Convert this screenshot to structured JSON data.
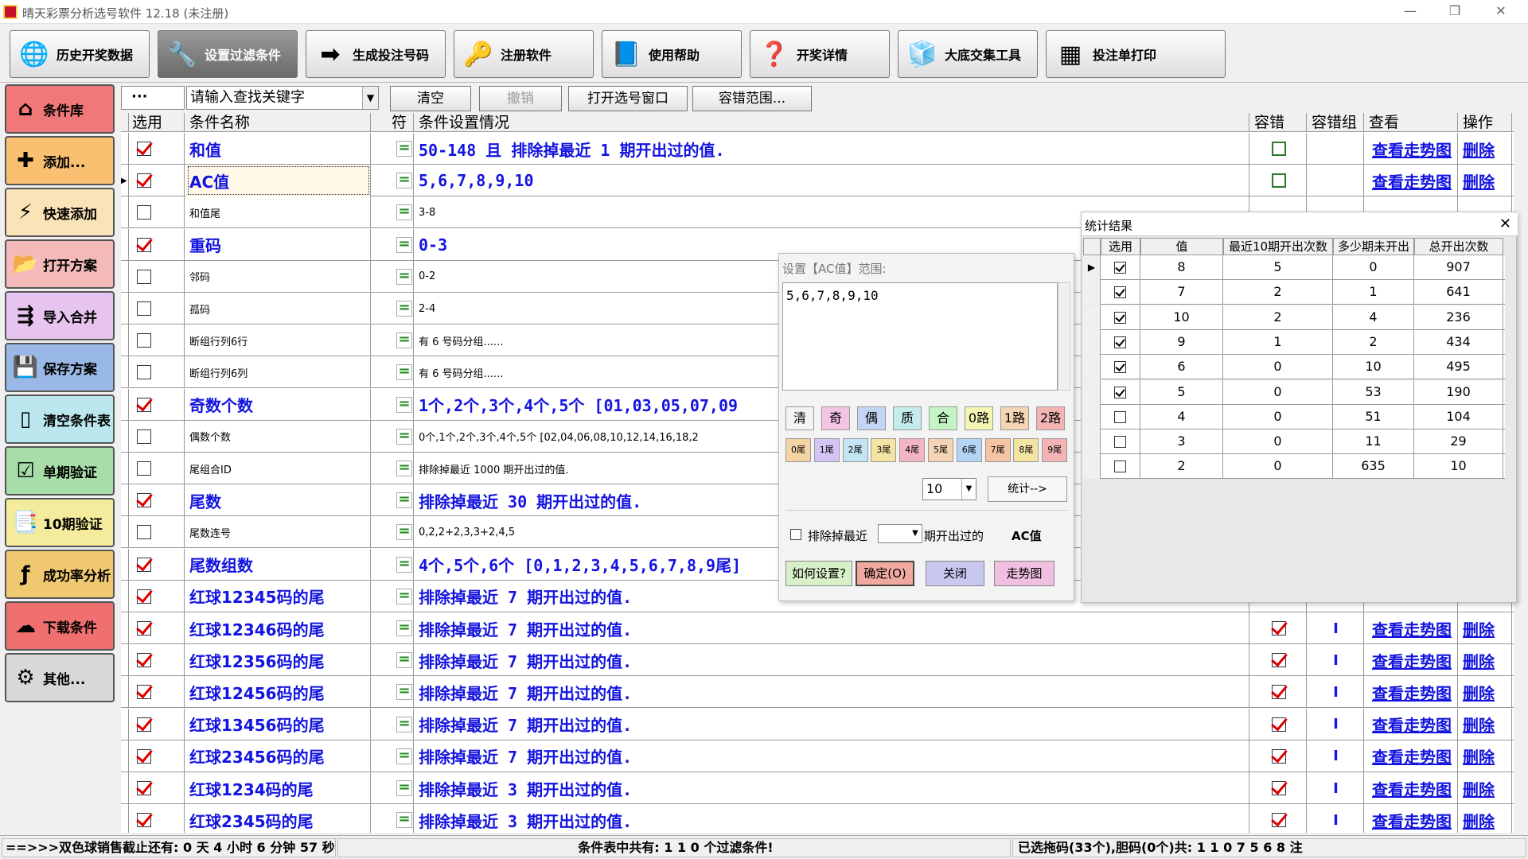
{
  "window": {
    "title": "晴天彩票分析选号软件 12.18 (未注册)",
    "min": "—",
    "max": "❐",
    "close": "✕"
  },
  "toolbar": [
    {
      "label": "历史开奖数据",
      "icon": "globe-icon",
      "glyph": "🌐"
    },
    {
      "label": "设置过滤条件",
      "icon": "tools-icon",
      "glyph": "🔧"
    },
    {
      "label": "生成投注号码",
      "icon": "arrow-right-icon",
      "glyph": "➡"
    },
    {
      "label": "注册软件",
      "icon": "key-icon",
      "glyph": "🔑"
    },
    {
      "label": "使用帮助",
      "icon": "help-book-icon",
      "glyph": "📘"
    },
    {
      "label": "开奖详情",
      "icon": "question-icon",
      "glyph": "❓"
    },
    {
      "label": "大底交集工具",
      "icon": "cubes-icon",
      "glyph": "🧊"
    },
    {
      "label": "投注单打印",
      "icon": "print-icon",
      "glyph": "▦"
    }
  ],
  "sidebar": [
    {
      "label": "条件库",
      "icon": "house-icon",
      "glyph": "⌂",
      "bg": "#f07878"
    },
    {
      "label": "添加...",
      "icon": "plus-icon",
      "glyph": "✚",
      "bg": "#f8c070"
    },
    {
      "label": "快速添加",
      "icon": "lightning-icon",
      "glyph": "⚡",
      "bg": "#fbe3b8"
    },
    {
      "label": "打开方案",
      "icon": "folder-icon",
      "glyph": "📂",
      "bg": "#f4b9b9"
    },
    {
      "label": "导入合并",
      "icon": "merge-icon",
      "glyph": "⇶",
      "bg": "#e6c4ef"
    },
    {
      "label": "保存方案",
      "icon": "disk-icon",
      "glyph": "💾",
      "bg": "#9ab8e6"
    },
    {
      "label": "清空条件表",
      "icon": "document-icon",
      "glyph": "▯",
      "bg": "#bce6ee"
    },
    {
      "label": "单期验证",
      "icon": "checklist-icon",
      "glyph": "☑",
      "bg": "#a8dca8"
    },
    {
      "label": "10期验证",
      "icon": "checklist10-icon",
      "glyph": "📑",
      "bg": "#f4ec9c"
    },
    {
      "label": "成功率分析",
      "icon": "fx-icon",
      "glyph": "ƒ",
      "bg": "#f0c870"
    },
    {
      "label": "下载条件",
      "icon": "cloud-download-icon",
      "glyph": "☁",
      "bg": "#f07070"
    },
    {
      "label": "其他...",
      "icon": "gear-icon",
      "glyph": "⚙",
      "bg": "#d8d8d8"
    }
  ],
  "filterbar": {
    "dots": "···",
    "search_placeholder": "请输入查找关键字",
    "dd": "▼",
    "clear": "清空",
    "undo": "撤销",
    "open_window": "打开选号窗口",
    "tolerance": "容错范围..."
  },
  "grid": {
    "headers": [
      "选用",
      "条件名称",
      "符",
      "条件设置情况",
      "容错",
      "容错组",
      "查看",
      "操作"
    ],
    "rows": [
      {
        "on": true,
        "name": "和值",
        "big": true,
        "eq": "=",
        "setting": "50-148 且 排除掉最近 1 期开出过的值.",
        "tol": "box",
        "grp": "",
        "view": "查看走势图",
        "op": "删除"
      },
      {
        "on": true,
        "name": "AC值",
        "big": true,
        "eq": "=",
        "setting": "5,6,7,8,9,10",
        "tol": "box",
        "grp": "",
        "view": "查看走势图",
        "op": "删除",
        "sel": true
      },
      {
        "on": false,
        "name": "和值尾",
        "big": false,
        "eq": "=",
        "setting": "3-8",
        "tol": "",
        "grp": "",
        "view": "",
        "op": ""
      },
      {
        "on": true,
        "name": "重码",
        "big": true,
        "eq": "=",
        "setting": "0-3",
        "tol": "",
        "grp": "",
        "view": "",
        "op": ""
      },
      {
        "on": false,
        "name": "邻码",
        "big": false,
        "eq": "=",
        "setting": "0-2",
        "tol": "",
        "grp": "",
        "view": "",
        "op": ""
      },
      {
        "on": false,
        "name": "孤码",
        "big": false,
        "eq": "=",
        "setting": "2-4",
        "tol": "",
        "grp": "",
        "view": "",
        "op": ""
      },
      {
        "on": false,
        "name": "断组行列6行",
        "big": false,
        "eq": "=",
        "setting": "有 6 号码分组......",
        "tol": "",
        "grp": "",
        "view": "",
        "op": ""
      },
      {
        "on": false,
        "name": "断组行列6列",
        "big": false,
        "eq": "=",
        "setting": "有 6 号码分组......",
        "tol": "",
        "grp": "",
        "view": "",
        "op": ""
      },
      {
        "on": true,
        "name": "奇数个数",
        "big": true,
        "eq": "=",
        "setting": "1个,2个,3个,4个,5个   [01,03,05,07,09",
        "tol": "",
        "grp": "",
        "view": "",
        "op": ""
      },
      {
        "on": false,
        "name": "偶数个数",
        "big": false,
        "eq": "=",
        "setting": "0个,1个,2个,3个,4个,5个   [02,04,06,08,10,12,14,16,18,2",
        "tol": "",
        "grp": "",
        "view": "",
        "op": ""
      },
      {
        "on": false,
        "name": "尾组合ID",
        "big": false,
        "eq": "=",
        "setting": "排除掉最近 1000 期开出过的值.",
        "tol": "",
        "grp": "",
        "view": "",
        "op": ""
      },
      {
        "on": true,
        "name": "尾数",
        "big": true,
        "eq": "=",
        "setting": "排除掉最近 30 期开出过的值.",
        "tol": "",
        "grp": "",
        "view": "",
        "op": ""
      },
      {
        "on": false,
        "name": "尾数连号",
        "big": false,
        "eq": "=",
        "setting": "0,2,2+2,3,3+2,4,5",
        "tol": "",
        "grp": "",
        "view": "",
        "op": ""
      },
      {
        "on": true,
        "name": "尾数组数",
        "big": true,
        "eq": "=",
        "setting": "4个,5个,6个   [0,1,2,3,4,5,6,7,8,9尾]",
        "tol": "",
        "grp": "",
        "view": "",
        "op": ""
      },
      {
        "on": true,
        "name": "红球12345码的尾",
        "big": true,
        "eq": "=",
        "setting": "排除掉最近 7 期开出过的值.",
        "tol": "",
        "grp": "",
        "view": "",
        "op": ""
      },
      {
        "on": true,
        "name": "红球12346码的尾",
        "big": true,
        "eq": "=",
        "setting": "排除掉最近 7 期开出过的值.",
        "tol": "on",
        "grp": "I",
        "view": "查看走势图",
        "op": "删除"
      },
      {
        "on": true,
        "name": "红球12356码的尾",
        "big": true,
        "eq": "=",
        "setting": "排除掉最近 7 期开出过的值.",
        "tol": "on",
        "grp": "I",
        "view": "查看走势图",
        "op": "删除"
      },
      {
        "on": true,
        "name": "红球12456码的尾",
        "big": true,
        "eq": "=",
        "setting": "排除掉最近 7 期开出过的值.",
        "tol": "on",
        "grp": "I",
        "view": "查看走势图",
        "op": "删除"
      },
      {
        "on": true,
        "name": "红球13456码的尾",
        "big": true,
        "eq": "=",
        "setting": "排除掉最近 7 期开出过的值.",
        "tol": "on",
        "grp": "I",
        "view": "查看走势图",
        "op": "删除"
      },
      {
        "on": true,
        "name": "红球23456码的尾",
        "big": true,
        "eq": "=",
        "setting": "排除掉最近 7 期开出过的值.",
        "tol": "on",
        "grp": "I",
        "view": "查看走势图",
        "op": "删除"
      },
      {
        "on": true,
        "name": "红球1234码的尾",
        "big": true,
        "eq": "=",
        "setting": "排除掉最近 3 期开出过的值.",
        "tol": "on",
        "grp": "I",
        "view": "查看走势图",
        "op": "删除"
      },
      {
        "on": true,
        "name": "红球2345码的尾",
        "big": true,
        "eq": "=",
        "setting": "排除掉最近 3 期开出过的值.",
        "tol": "on",
        "grp": "I",
        "view": "查看走势图",
        "op": "删除"
      }
    ]
  },
  "dialog": {
    "title": "设置【AC值】范围:",
    "text": "5,6,7,8,9,10",
    "keys1": [
      "清",
      "奇",
      "偶",
      "质",
      "合",
      "0路",
      "1路",
      "2路"
    ],
    "keys2": [
      "0尾",
      "1尾",
      "2尾",
      "3尾",
      "4尾",
      "5尾",
      "6尾",
      "7尾",
      "8尾",
      "9尾"
    ],
    "count_value": "10",
    "stat_btn": "统计-->",
    "exclude_label": "排除掉最近",
    "exclude_suffix": "期开出过的",
    "exclude_field": "AC值",
    "btn_how": "如何设置?",
    "btn_ok": "确定(O)",
    "btn_close": "关闭",
    "btn_trend": "走势图"
  },
  "stats": {
    "title": "统计结果",
    "close": "✕",
    "headers": [
      "选用",
      "值",
      "最近10期开出次数",
      "多少期未开出",
      "总开出次数"
    ],
    "rows": [
      {
        "on": true,
        "v": "8",
        "r10": "5",
        "miss": "0",
        "total": "907"
      },
      {
        "on": true,
        "v": "7",
        "r10": "2",
        "miss": "1",
        "total": "641"
      },
      {
        "on": true,
        "v": "10",
        "r10": "2",
        "miss": "4",
        "total": "236"
      },
      {
        "on": true,
        "v": "9",
        "r10": "1",
        "miss": "2",
        "total": "434"
      },
      {
        "on": true,
        "v": "6",
        "r10": "0",
        "miss": "10",
        "total": "495"
      },
      {
        "on": true,
        "v": "5",
        "r10": "0",
        "miss": "53",
        "total": "190"
      },
      {
        "on": false,
        "v": "4",
        "r10": "0",
        "miss": "51",
        "total": "104"
      },
      {
        "on": false,
        "v": "3",
        "r10": "0",
        "miss": "11",
        "total": "29"
      },
      {
        "on": false,
        "v": "2",
        "r10": "0",
        "miss": "635",
        "total": "10"
      }
    ]
  },
  "status": {
    "countdown": "==>>>双色球销售截止还有: 0 天 4 小时 6 分钟 57 秒",
    "total": "条件表中共有: 1 1 0 个过滤条件!",
    "selected": "已选拖码(33个),胆码(0个)共: 1 1 0 7 5 6 8 注"
  }
}
